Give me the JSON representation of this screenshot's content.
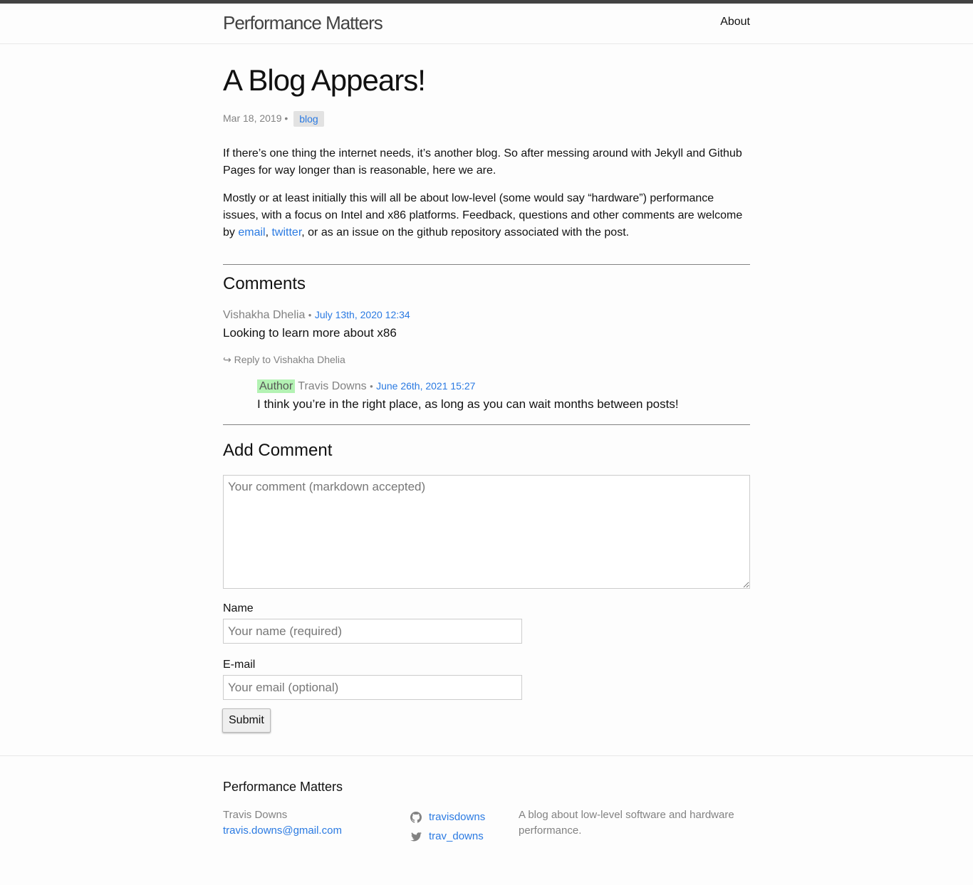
{
  "header": {
    "site_title": "Performance Matters",
    "nav_about": "About"
  },
  "post": {
    "title": "A Blog Appears!",
    "date": "Mar 18, 2019",
    "meta_separator": "•",
    "tag": "blog",
    "p1": "If there’s one thing the internet needs, it’s another blog. So after messing around with Jekyll and Github Pages for way longer than is reasonable, here we are.",
    "p2_before": "Mostly or at least initially this will all be about low-level (some would say “hardware”) performance issues, with a focus on Intel and x86 platforms. Feedback, questions and other comments are welcome by ",
    "p2_link_email": "email",
    "p2_comma": ", ",
    "p2_link_twitter": "twitter",
    "p2_after": ", or as an issue on the github repository associated with the post."
  },
  "comments": {
    "title": "Comments",
    "items": [
      {
        "author": "Vishakha Dhelia",
        "separator": "•",
        "date": "July 13th, 2020 12:34",
        "body": "Looking to learn more about x86",
        "reply_label": "↪ Reply to Vishakha Dhelia"
      }
    ],
    "reply": {
      "badge": "Author",
      "author": "Travis Downs",
      "separator": "•",
      "date": "June 26th, 2021 15:27",
      "body": "I think you’re in the right place, as long as you can wait months between posts!"
    }
  },
  "add_comment": {
    "title": "Add Comment",
    "comment_placeholder": "Your comment (markdown accepted)",
    "name_label": "Name",
    "name_placeholder": "Your name (required)",
    "email_label": "E-mail",
    "email_placeholder": "Your email (optional)",
    "submit_label": "Submit"
  },
  "footer": {
    "heading": "Performance Matters",
    "author_name": "Travis Downs",
    "author_email": "travis.downs@gmail.com",
    "github_user": "travisdowns",
    "twitter_user": "trav_downs",
    "description": "A blog about low-level software and hardware performance.",
    "github_icon": "github-icon",
    "twitter_icon": "twitter-icon"
  }
}
